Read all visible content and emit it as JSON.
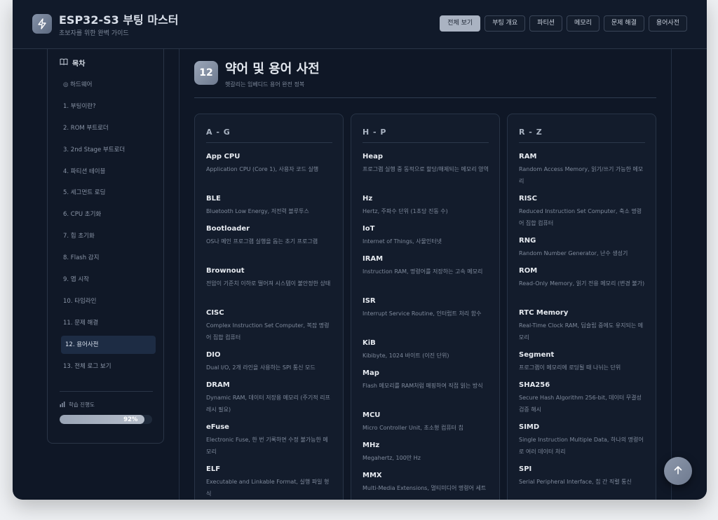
{
  "header": {
    "title": "ESP32-S3 부팅 마스터",
    "subtitle": "초보자를 위한 완벽 가이드",
    "app_icon": "lightning-icon",
    "nav": [
      {
        "label": "전체 보기",
        "active": true
      },
      {
        "label": "부팅 개요",
        "active": false
      },
      {
        "label": "파티션",
        "active": false
      },
      {
        "label": "메모리",
        "active": false
      },
      {
        "label": "문제 해결",
        "active": false
      },
      {
        "label": "용어사전",
        "active": false
      }
    ]
  },
  "sidebar": {
    "toc_icon": "book-icon",
    "toc_title": "목차",
    "items": [
      {
        "label": "◎ 하드웨어",
        "active": false
      },
      {
        "label": "1. 부팅이란?",
        "active": false
      },
      {
        "label": "2. ROM 부트로더",
        "active": false
      },
      {
        "label": "3. 2nd Stage 부트로더",
        "active": false
      },
      {
        "label": "4. 파티션 테이블",
        "active": false
      },
      {
        "label": "5. 세그먼트 로딩",
        "active": false
      },
      {
        "label": "6. CPU 초기화",
        "active": false
      },
      {
        "label": "7. 힙 초기화",
        "active": false
      },
      {
        "label": "8. Flash 감지",
        "active": false
      },
      {
        "label": "9. 앱 시작",
        "active": false
      },
      {
        "label": "10. 타임라인",
        "active": false
      },
      {
        "label": "11. 문제 해결",
        "active": false
      },
      {
        "label": "12. 용어사전",
        "active": true
      },
      {
        "label": "13. 전체 로그 보기",
        "active": false
      }
    ],
    "progress": {
      "icon": "bar-chart-icon",
      "label": "학습 진행도",
      "value": 0.92,
      "text": "92%"
    }
  },
  "section": {
    "number": "12",
    "title": "약어 및 용어 사전",
    "subtitle": "헷갈리는 임베디드 용어 완전 정복"
  },
  "glossary": [
    {
      "heading": "A - G",
      "terms": [
        {
          "name": "App CPU",
          "desc": "Application CPU (Core 1), 사용자 코드 실행",
          "lines": 2
        },
        {
          "name": "BLE",
          "desc": "Bluetooth Low Energy, 저전력 블루투스",
          "lines": 1
        },
        {
          "name": "Bootloader",
          "desc": "OS나 메인 프로그램 실행을 돕는 초기 프로그램",
          "lines": 2
        },
        {
          "name": "Brownout",
          "desc": "전압이 기준치 이하로 떨어져 시스템이 불안정한 상태",
          "lines": 2
        },
        {
          "name": "CISC",
          "desc": "Complex Instruction Set Computer, 복잡 명령어 집합 컴퓨터",
          "lines": 2
        },
        {
          "name": "DIO",
          "desc": "Dual I/O, 2개 라인을 사용하는 SPI 통신 모드",
          "lines": 1
        },
        {
          "name": "DRAM",
          "desc": "Dynamic RAM, 데이터 저장용 메모리 (주기적 리프레시 필요)",
          "lines": 2
        },
        {
          "name": "eFuse",
          "desc": "Electronic Fuse, 한 번 기록하면 수정 불가능한 메모리",
          "lines": 2
        },
        {
          "name": "ELF",
          "desc": "Executable and Linkable Format, 실행 파일 형식",
          "lines": 2
        }
      ]
    },
    {
      "heading": "H - P",
      "terms": [
        {
          "name": "Heap",
          "desc": "프로그램 실행 중 동적으로 할당/해제되는 메모리 영역",
          "lines": 2
        },
        {
          "name": "Hz",
          "desc": "Hertz, 주파수 단위 (1초당 진동 수)",
          "lines": 1
        },
        {
          "name": "IoT",
          "desc": "Internet of Things, 사물인터넷",
          "lines": 1
        },
        {
          "name": "IRAM",
          "desc": "Instruction RAM, 명령어를 저장하는 고속 메모리",
          "lines": 2
        },
        {
          "name": "ISR",
          "desc": "Interrupt Service Routine, 인터럽트 처리 함수",
          "lines": 2
        },
        {
          "name": "KiB",
          "desc": "Kibibyte, 1024 바이트 (이진 단위)",
          "lines": 1
        },
        {
          "name": "Map",
          "desc": "Flash 메모리를 RAM처럼 매핑하여 직접 읽는 방식",
          "lines": 2
        },
        {
          "name": "MCU",
          "desc": "Micro Controller Unit, 초소형 컴퓨터 칩",
          "lines": 1
        },
        {
          "name": "MHz",
          "desc": "Megahertz, 100만 Hz",
          "lines": 1
        },
        {
          "name": "MMX",
          "desc": "Multi-Media Extensions, 멀티미디어 명령어 세트",
          "lines": 2
        }
      ]
    },
    {
      "heading": "R - Z",
      "terms": [
        {
          "name": "RAM",
          "desc": "Random Access Memory, 읽기/쓰기 가능한 메모리",
          "lines": 2
        },
        {
          "name": "RISC",
          "desc": "Reduced Instruction Set Computer, 축소 명령어 집합 컴퓨터",
          "lines": 2
        },
        {
          "name": "RNG",
          "desc": "Random Number Generator, 난수 생성기",
          "lines": 1
        },
        {
          "name": "ROM",
          "desc": "Read-Only Memory, 읽기 전용 메모리 (변경 불가)",
          "lines": 2
        },
        {
          "name": "RTC Memory",
          "desc": "Real-Time Clock RAM, 딥슬립 중에도 유지되는 메모리",
          "lines": 2
        },
        {
          "name": "Segment",
          "desc": "프로그램이 메모리에 로딩될 때 나뉘는 단위",
          "lines": 1
        },
        {
          "name": "SHA256",
          "desc": "Secure Hash Algorithm 256-bit, 데이터 무결성 검증 해시",
          "lines": 2
        },
        {
          "name": "SIMD",
          "desc": "Single Instruction Multiple Data, 하나의 명령어로 여러 데이터 처리",
          "lines": 2
        },
        {
          "name": "SPI",
          "desc": "Serial Peripheral Interface, 칩 간 직렬 통신",
          "lines": 2
        }
      ]
    }
  ],
  "back_to_top_icon": "arrow-up-icon"
}
